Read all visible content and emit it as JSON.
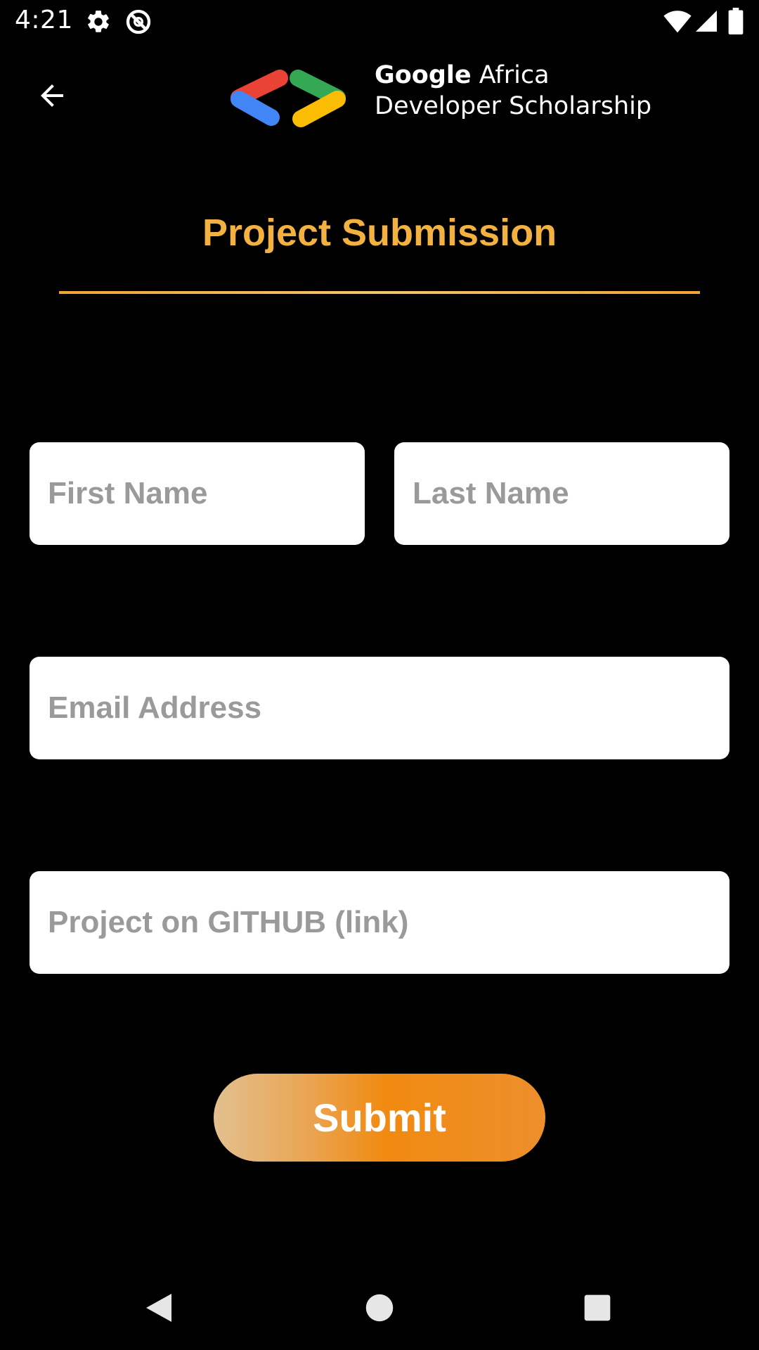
{
  "status_bar": {
    "time": "4:21",
    "icons": [
      "settings-icon",
      "no-sync-icon",
      "wifi-icon",
      "signal-icon",
      "battery-icon"
    ]
  },
  "app_bar": {
    "back_icon": "arrow-back-icon",
    "brand_logo": "gads-logo",
    "brand_line1_google": "Google",
    "brand_line1_rest": " Africa",
    "brand_line2": "Developer Scholarship"
  },
  "form": {
    "title": "Project Submission",
    "first_name_placeholder": "First Name",
    "last_name_placeholder": "Last Name",
    "email_placeholder": "Email Address",
    "github_placeholder": "Project on GITHUB (link)",
    "first_name_value": "",
    "last_name_value": "",
    "email_value": "",
    "github_value": "",
    "submit_label": "Submit"
  },
  "nav_bar": {
    "items": [
      "back-triangle-icon",
      "home-circle-icon",
      "recents-square-icon"
    ]
  },
  "colors": {
    "background": "#000000",
    "accent": "#f3b23f",
    "submit_gradient_start": "#e2c08f",
    "submit_gradient_mid": "#f18a10",
    "input_background": "#ffffff",
    "placeholder": "#9a9a9a"
  }
}
